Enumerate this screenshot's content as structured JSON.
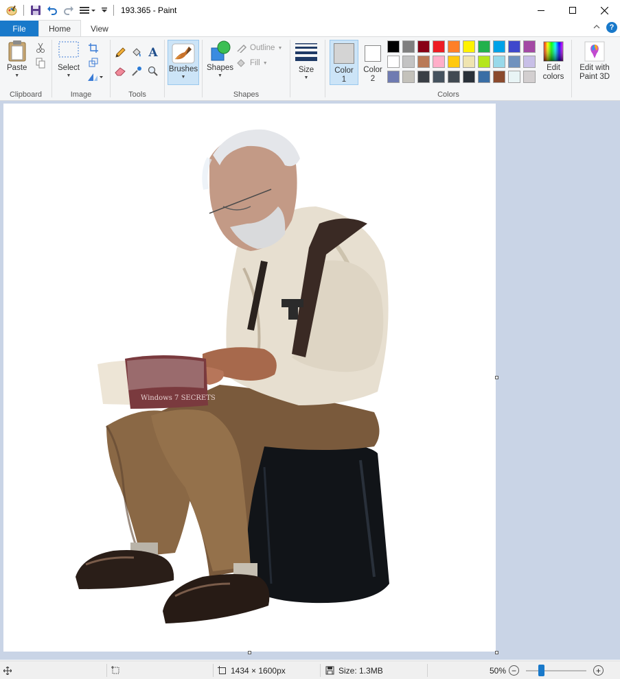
{
  "window": {
    "title": "193.365 - Paint",
    "minimize_glyph": "—",
    "maximize_glyph": "☐",
    "close_glyph": "✕"
  },
  "tabs": {
    "file": "File",
    "home": "Home",
    "view": "View"
  },
  "ribbon": {
    "clipboard": {
      "label": "Clipboard",
      "paste": "Paste"
    },
    "image": {
      "label": "Image",
      "select": "Select"
    },
    "tools": {
      "label": "Tools",
      "text_glyph": "A"
    },
    "brushes": {
      "label": "Brushes"
    },
    "shapes": {
      "label": "Shapes",
      "shapes_btn": "Shapes",
      "outline": "Outline",
      "fill": "Fill"
    },
    "size": {
      "label": "Size"
    },
    "colors": {
      "label": "Colors",
      "color1": "Color",
      "color1_num": "1",
      "color2": "Color",
      "color2_num": "2",
      "edit_colors_1": "Edit",
      "edit_colors_2": "colors",
      "color1_value": "#d4d4d4",
      "color2_value": "#ffffff",
      "palette": [
        [
          "#000000",
          "#7f7f7f",
          "#880015",
          "#ed1c24",
          "#ff7f27",
          "#fff200",
          "#22b14c",
          "#00a2e8",
          "#3f48cc",
          "#a349a4"
        ],
        [
          "#ffffff",
          "#c3c3c3",
          "#b97a57",
          "#ffaec9",
          "#ffc90e",
          "#efe4b0",
          "#b5e61d",
          "#99d9ea",
          "#7092be",
          "#c8bfe7"
        ],
        [
          "#6f7bb1",
          "#c4c2bb",
          "#3a3f45",
          "#45525e",
          "#414a52",
          "#2a3139",
          "#3a6ea5",
          "#8b4a2d",
          "#e8f4f5",
          "#d3cfd0"
        ]
      ]
    },
    "paint3d": {
      "line1": "Edit with",
      "line2": "Paint 3D"
    }
  },
  "canvas": {
    "book_title": "Windows 7 SECRETS"
  },
  "statusbar": {
    "dimensions": "1434 × 1600px",
    "size": "Size: 1.3MB",
    "zoom": "50%",
    "zoom_minus": "−",
    "zoom_plus": "+"
  }
}
